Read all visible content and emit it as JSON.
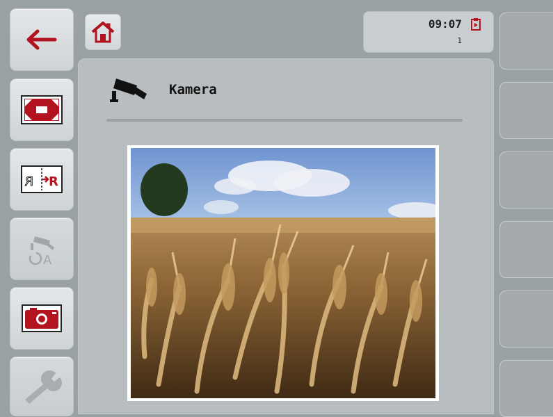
{
  "status": {
    "time": "09:07",
    "counter": "1"
  },
  "page": {
    "title": "Kamera"
  },
  "softkeys": [
    {
      "icon": "back-arrow-icon"
    },
    {
      "icon": "fullscreen-icon"
    },
    {
      "icon": "mirror-image-icon"
    },
    {
      "icon": "camera-auto-switch-icon",
      "disabled": true
    },
    {
      "icon": "snapshot-camera-icon"
    },
    {
      "icon": "wrench-icon",
      "disabled": true
    }
  ],
  "colors": {
    "accent": "#b3121f",
    "background": "#9aa1a5",
    "panel": "#b8bdc0"
  },
  "auto_label": "A",
  "mirror_label": "R"
}
